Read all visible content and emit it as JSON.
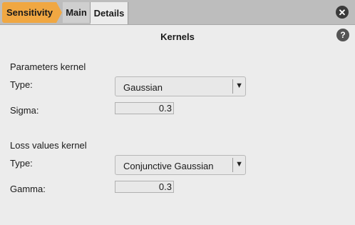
{
  "tabs": {
    "sensitivity": "Sensitivity",
    "main": "Main",
    "details": "Details"
  },
  "icons": {
    "close": "close-icon",
    "help": "help-icon",
    "dropdown": "chevron-down-icon"
  },
  "colors": {
    "active_tab": "#f0a742",
    "background": "#ececec",
    "tabbar": "#bdbdbd"
  },
  "panel": {
    "title": "Kernels",
    "params": {
      "section_label": "Parameters kernel",
      "type_label": "Type:",
      "type_value": "Gaussian",
      "sigma_label": "Sigma:",
      "sigma_value": "0.3"
    },
    "loss": {
      "section_label": "Loss values kernel",
      "type_label": "Type:",
      "type_value": "Conjunctive Gaussian",
      "gamma_label": "Gamma:",
      "gamma_value": "0.3"
    }
  }
}
